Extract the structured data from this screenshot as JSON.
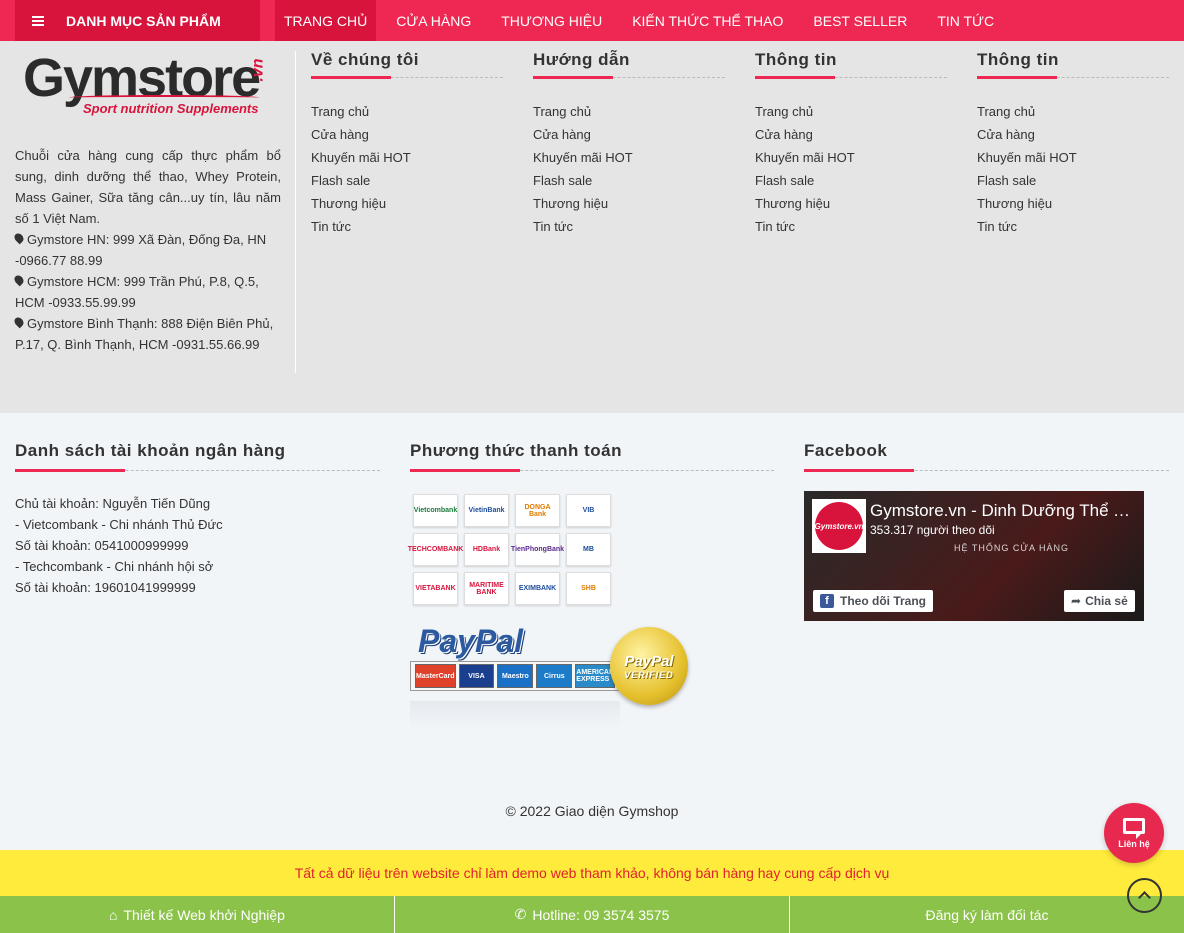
{
  "nav": {
    "category_label": "DANH MỤC SẢN PHẨM",
    "items": [
      {
        "label": "TRANG CHỦ",
        "active": true
      },
      {
        "label": "CỬA HÀNG"
      },
      {
        "label": "THƯƠNG HIỆU"
      },
      {
        "label": "KIẾN THỨC THỂ THAO"
      },
      {
        "label": "BEST SELLER"
      },
      {
        "label": "TIN TỨC"
      }
    ]
  },
  "about": {
    "logo_text": "Gymstore",
    "logo_vn": ".vn",
    "logo_tagline": "Sport nutrition Supplements",
    "description": "Chuỗi cửa hàng cung cấp thực phẩm bổ sung, dinh dưỡng thể thao, Whey Protein, Mass Gainer, Sữa tăng cân...uy tín, lâu năm số 1 Việt Nam.",
    "addresses": [
      "Gymstore HN: 999 Xã Đàn, Đống Đa, HN -0966.77 88.99",
      "Gymstore HCM: 999 Trần Phú, P.8, Q.5, HCM -0933.55.99.99",
      "Gymstore Bình Thạnh: 888 Điện Biên Phủ, P.17, Q. Bình Thạnh, HCM -0931.55.66.99"
    ]
  },
  "columns": [
    {
      "title": "Về chúng tôi",
      "links": [
        "Trang chủ",
        "Cửa hàng",
        "Khuyến mãi HOT",
        "Flash sale",
        "Thương hiệu",
        "Tin tức"
      ]
    },
    {
      "title": "Hướng dẫn",
      "links": [
        "Trang chủ",
        "Cửa hàng",
        "Khuyến mãi HOT",
        "Flash sale",
        "Thương hiệu",
        "Tin tức"
      ]
    },
    {
      "title": "Thông tin",
      "links": [
        "Trang chủ",
        "Cửa hàng",
        "Khuyến mãi HOT",
        "Flash sale",
        "Thương hiệu",
        "Tin tức"
      ]
    },
    {
      "title": "Thông tin",
      "links": [
        "Trang chủ",
        "Cửa hàng",
        "Khuyến mãi HOT",
        "Flash sale",
        "Thương hiệu",
        "Tin tức"
      ]
    }
  ],
  "bank_accounts": {
    "title": "Danh sách tài khoản ngân hàng",
    "lines": [
      "Chủ tài khoản: Nguyễn Tiến Dũng",
      "- Vietcombank - Chi nhánh Thủ Đức",
      "Số tài khoản: 0541000999999",
      "- Techcombank - Chi nhánh hội sở",
      "Số tài khoản: 19601041999999"
    ]
  },
  "payment": {
    "title": "Phương thức thanh toán",
    "banks": [
      {
        "name": "Vietcombank",
        "color": "#1a7a3a"
      },
      {
        "name": "VietinBank",
        "color": "#1c4c9c"
      },
      {
        "name": "DONGA Bank",
        "color": "#e07b00"
      },
      {
        "name": "VIB",
        "color": "#1c4c9c"
      },
      {
        "name": "TECHCOMBANK",
        "color": "#d8143c"
      },
      {
        "name": "HDBank",
        "color": "#d8143c"
      },
      {
        "name": "TienPhongBank",
        "color": "#5a2a8a"
      },
      {
        "name": "MB",
        "color": "#1c4c9c"
      },
      {
        "name": "VIETABANK",
        "color": "#d8143c"
      },
      {
        "name": "MARITIME BANK",
        "color": "#d8143c"
      },
      {
        "name": "EXIMBANK",
        "color": "#1c4c9c"
      },
      {
        "name": "SHB",
        "color": "#e07b00"
      }
    ],
    "paypal_word": "PayPal",
    "paypal_cards": [
      {
        "name": "MasterCard",
        "color": "#e0412b"
      },
      {
        "name": "VISA",
        "color": "#1a3f8f"
      },
      {
        "name": "Maestro",
        "color": "#1a6fc7"
      },
      {
        "name": "Cirrus",
        "color": "#1c7cc9"
      },
      {
        "name": "AMERICAN EXPRESS",
        "color": "#2b8ac9"
      }
    ],
    "badge_top": "PayPal",
    "badge_bottom": "VERIFIED"
  },
  "facebook": {
    "title": "Facebook",
    "page_name": "Gymstore.vn - Dinh Dưỡng Thể Thao",
    "followers": "353.317 người theo dõi",
    "avatar_text": "Gymstore.vn",
    "store_label": "HỆ THỐNG CỬA HÀNG",
    "follow_label": "Theo dõi Trang",
    "share_label": "Chia sẻ"
  },
  "copyright": "© 2022 Giao diện Gymshop",
  "notice": "Tất cả dữ liệu trên website chỉ làm demo web tham khảo, không bán hàng hay cung cấp dịch vụ",
  "bottom_bar": [
    {
      "label": "Thiết kế Web khởi Nghiệp",
      "icon": "home-icon"
    },
    {
      "label": "Hotline: 09 3574 3575",
      "icon": "phone-icon"
    },
    {
      "label": "Đăng ký làm đối tác",
      "icon": ""
    }
  ],
  "contact_label": "Liên hệ"
}
